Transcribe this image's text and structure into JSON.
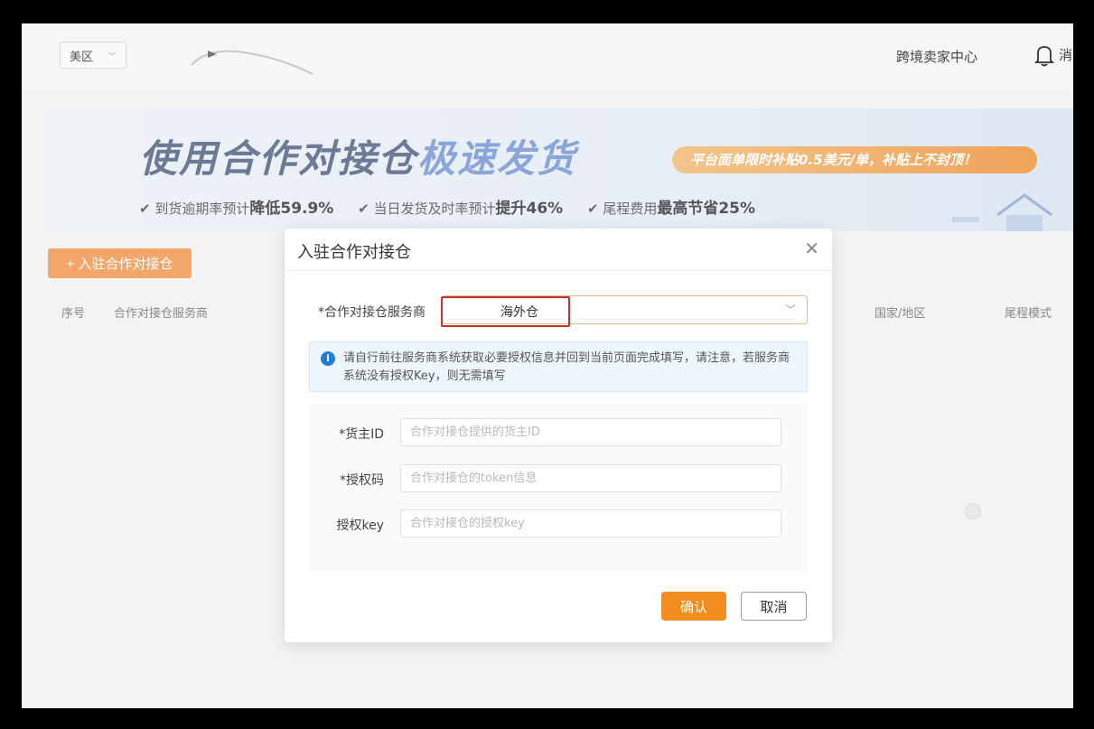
{
  "header": {
    "region": "美区",
    "seller_center": "跨境卖家中心",
    "msg_partial": "消"
  },
  "banner": {
    "title_part1": "使用合作对接仓",
    "title_part2": "极速发货",
    "pill": "平台面单限时补贴0.5美元/单，补贴上不封顶！",
    "stats": [
      {
        "prefix": "到货逾期率预计",
        "strong": "降低59.9%"
      },
      {
        "prefix": "当日发货及时率预计",
        "strong": "提升46%"
      },
      {
        "prefix": "尾程费用",
        "strong": "最高节省25%"
      }
    ]
  },
  "list": {
    "add_button": "+ 入驻合作对接仓",
    "columns": {
      "index": "序号",
      "provider": "合作对接仓服务商",
      "country": "国家/地区",
      "last_mile": "尾程模式"
    }
  },
  "modal": {
    "title": "入驻合作对接仓",
    "provider_label": "*合作对接仓服务商",
    "provider_value": "海外仓",
    "notice": "请自行前往服务商系统获取必要授权信息并回到当前页面完成填写，请注意，若服务商系统没有授权Key，则无需填写",
    "fields": {
      "owner_id": {
        "label": "*货主ID",
        "placeholder": "合作对接仓提供的货主ID"
      },
      "auth_code": {
        "label": "*授权码",
        "placeholder": "合作对接仓的token信息"
      },
      "auth_key": {
        "label": "授权key",
        "placeholder": "合作对接仓的授权key"
      }
    },
    "confirm": "确认",
    "cancel": "取消"
  },
  "colors": {
    "accent": "#f28c1c",
    "highlight_box": "#c9322b",
    "info": "#1f7ed8"
  }
}
